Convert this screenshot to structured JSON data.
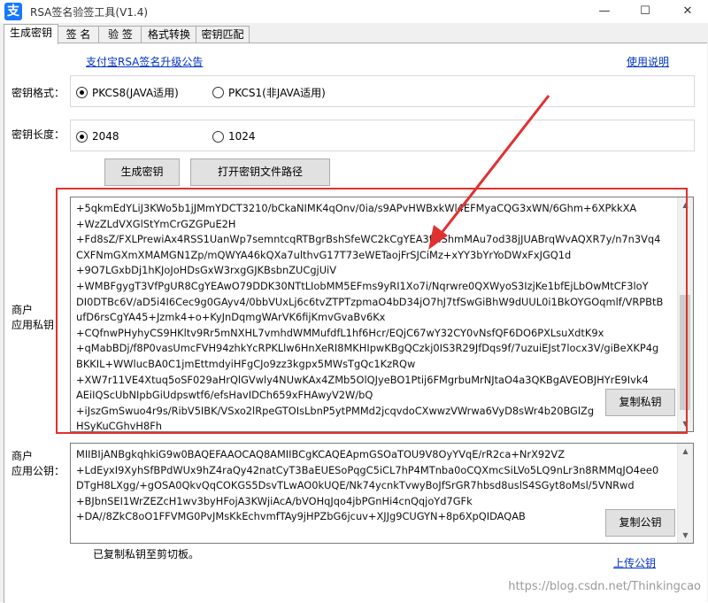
{
  "window": {
    "title": "RSA签名验签工具(V1.4)",
    "app_icon": "支",
    "minimize": "—",
    "maximize": "☐",
    "close": "✕"
  },
  "tabs": [
    {
      "label": "生成密钥",
      "active": true
    },
    {
      "label": "签  名",
      "active": false
    },
    {
      "label": "验  签",
      "active": false
    },
    {
      "label": "格式转换",
      "active": false
    },
    {
      "label": "密钥匹配",
      "active": false
    }
  ],
  "links": {
    "announcement": "支付宝RSA签名升级公告",
    "help": "使用说明",
    "upload": "上传公钥"
  },
  "key_format": {
    "label": "密钥格式：",
    "options": [
      {
        "label": "PKCS8(JAVA适用)",
        "checked": true
      },
      {
        "label": "PKCS1(非JAVA适用)",
        "checked": false
      }
    ]
  },
  "key_length": {
    "label": "密钥长度：",
    "options": [
      {
        "label": "2048",
        "checked": true
      },
      {
        "label": "1024",
        "checked": false
      }
    ]
  },
  "buttons": {
    "generate": "生成密钥",
    "open_path": "打开密钥文件路径",
    "copy_private": "复制私钥",
    "copy_public": "复制公钥"
  },
  "private_key": {
    "label_line1": "商户",
    "label_line2": "应用私钥：",
    "lines": [
      "+5qkmEdYLiJ3KWo5b1jJMmYDCT3210/bCkaNIMK4qOnv/0ia/s9APvHWBxkWl4EFMyaCQG3xWN/6Ghm+6XPkkXA",
      "+WzZLdVXGlStYmCrGZGPuE2H",
      "+Fd8sZ/FXLPrewiAx4RSS1UanWp7semntcqRTBgrBshSfeWC2kCgYEA3fMShmMAu7od38jJUABrqWvAQXR7y/n7n3Vq4",
      "CXFNmGXmXMAMGN1Zp/mQWYA46kQXa7ulthvG17T73eWETaojFrSJCiMz+xYY3bYrYoDWxFxJGQ1d",
      "+9O7LGxbDj1hKJoJoHDsGxW3rxgGJKBsbnZUCgjUiV",
      "+WMBFgygT3VfPgUR8CgYEAwO79DDK30NTtLIobMM5EFms9yRI1Xo7i/Nqrwre0QXWyoS3IzjKe1bfEjLbOwMtCF3loY",
      "DI0DTBc6V/aD5i4I6Cec9g0GAyv4/0bbVUxLj6c6tvZTPTzpmaO4bD34jO7hJ7tfSwGiBhW9dUUL0i1BkOYGOqmlf/VRPBtB",
      "ufD6rsCgYA45+Jzmk4+o+KyJnDqmgWArVK6fijKmvGvaBv6Kx",
      "+CQfnwPHyhyCS9HKltv9Rr5mNXHL7vmhdWMMufdfL1hf6Hcr/EQjC67wY32CY0vNsfQF6DO6PXLsuXdtK9x",
      "+qMabBDj/f8P0vasUmcFVH94zhkYcRPKLlw6HnXeRI8MKHIpwKBgQCzkj0IS3R29JfDqs9f/7uzuiEJst7locx3V/giBeXKP4g",
      "BKKIL+WWlucBA0C1jmEttmdyiHFgCJo9zz3kgpx5MWsTgQc1KzRQw",
      "+XW7r11VE4Xtuq5oSF029aHrQlGVwly4NUwKAx4ZMb5OlQJyeBO1Ptij6FMgrbuMrNJtaO4a3QKBgAVEOBJHYrE9Ivk4",
      "AEiIQScUbNIpbGiUdpswtf6/efsHavIDCh659xFHAwyV2W/bQ",
      "+iJszGmSwuo4r9s/RibV5IBK/VSxo2lRpeGTOIsLbnP5ytPMMd2jcqvdoCXwwzVWrwa6VyD8sWr4b20BGlZg",
      "HSyKuCGhvH8Fh"
    ]
  },
  "public_key": {
    "label_line1": "商户",
    "label_line2": "应用公钥：",
    "lines": [
      "MIIBIjANBgkqhkiG9w0BAQEFAAOCAQ8AMIIBCgKCAQEApmGSOaTOU9V8OyYVqE/rR2ca+NrX92VZ",
      "+LdEyxI9XyhSfBPdWUx9hZ4raQy42natCyT3BaEUESoPqgC5iCL7hP4MTnba0oCQXmcSiLVo5LQ9nLr3n8RMMqJO4ee0",
      "DTgH8LXgg/+gOSA0QkvQqCOKGS5DsvTLwAO0kUQE/Nk74ycnkTvwyBoJfSrGR7hbsd8uslS4SGyt8oMsl/5VNRwd",
      "+BJbnSEI1WrZEZcH1wv3byHFojA3KWjiAcA/bVOHqJqo4jbPGnHi4cnQqjoYd7GFk",
      "+DA//8ZkC8oO1FFVMG0PvJMsKkEchvmfTAy9jHPZbG6jcuv+XJJg9CUGYN+8p6XpQIDAQAB"
    ]
  },
  "status": "已复制私钥至剪切板。",
  "watermark": "https://blog.csdn.net/Thinkingcao",
  "colors": {
    "link": "#0033cc",
    "highlight_box": "#e03131",
    "arrow": "#e03131"
  },
  "icons": {
    "scroll_up": "▲",
    "scroll_down": "▼"
  }
}
